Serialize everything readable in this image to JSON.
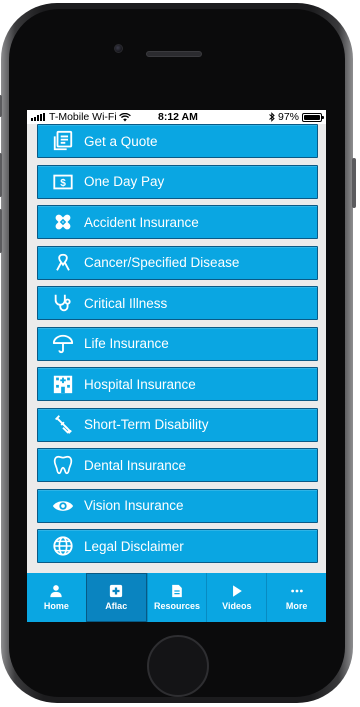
{
  "status_bar": {
    "carrier": "T-Mobile Wi-Fi",
    "time": "8:12 AM",
    "battery": "97%",
    "battery_level": 0.97,
    "bluetooth_icon": "bluetooth-icon",
    "wifi_icon": "wifi-icon"
  },
  "menu": {
    "items": [
      {
        "label": "Get a Quote",
        "icon": "quote-document-icon"
      },
      {
        "label": "One Day Pay",
        "icon": "dollar-bill-icon"
      },
      {
        "label": "Accident Insurance",
        "icon": "bandage-icon"
      },
      {
        "label": "Cancer/Specified Disease",
        "icon": "ribbon-icon"
      },
      {
        "label": "Critical Illness",
        "icon": "stethoscope-icon"
      },
      {
        "label": "Life Insurance",
        "icon": "umbrella-icon"
      },
      {
        "label": "Hospital Insurance",
        "icon": "hospital-icon"
      },
      {
        "label": "Short-Term Disability",
        "icon": "crutch-icon"
      },
      {
        "label": "Dental Insurance",
        "icon": "tooth-icon"
      },
      {
        "label": "Vision Insurance",
        "icon": "eye-icon"
      },
      {
        "label": "Legal Disclaimer",
        "icon": "globe-icon"
      }
    ]
  },
  "tabbar": {
    "tabs": [
      {
        "label": "Home",
        "icon": "person-icon",
        "active": false
      },
      {
        "label": "Aflac",
        "icon": "medical-cross-icon",
        "active": true
      },
      {
        "label": "Resources",
        "icon": "document-icon",
        "active": false
      },
      {
        "label": "Videos",
        "icon": "play-icon",
        "active": false
      },
      {
        "label": "More",
        "icon": "more-dots-icon",
        "active": false
      }
    ]
  },
  "colors": {
    "accent": "#0aa6e2",
    "accent_dark": "#0a84c0",
    "border": "#0a5a86",
    "screen_bg": "#ebebeb"
  }
}
